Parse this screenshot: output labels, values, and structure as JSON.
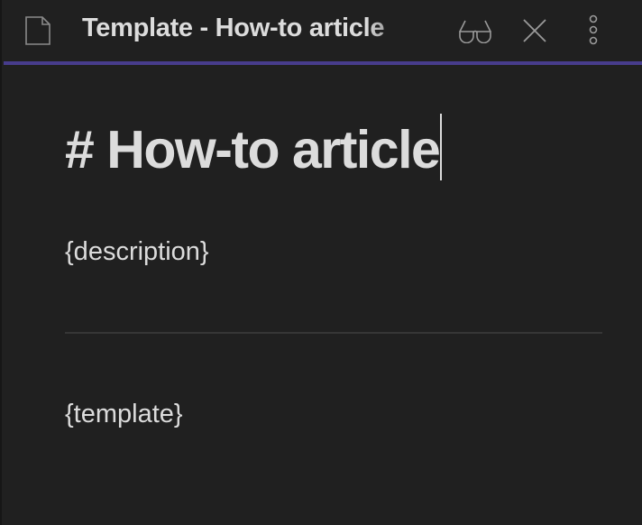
{
  "tab": {
    "title": "Template - How-to article",
    "icons": [
      "file-icon",
      "reading-view-icon",
      "close-icon",
      "more-options-icon"
    ]
  },
  "editor": {
    "heading": "# How-to article",
    "description": "{description}",
    "template": "{template}"
  },
  "colors": {
    "background": "#202020",
    "accent": "#473c8c",
    "text": "#dcdcdc"
  }
}
